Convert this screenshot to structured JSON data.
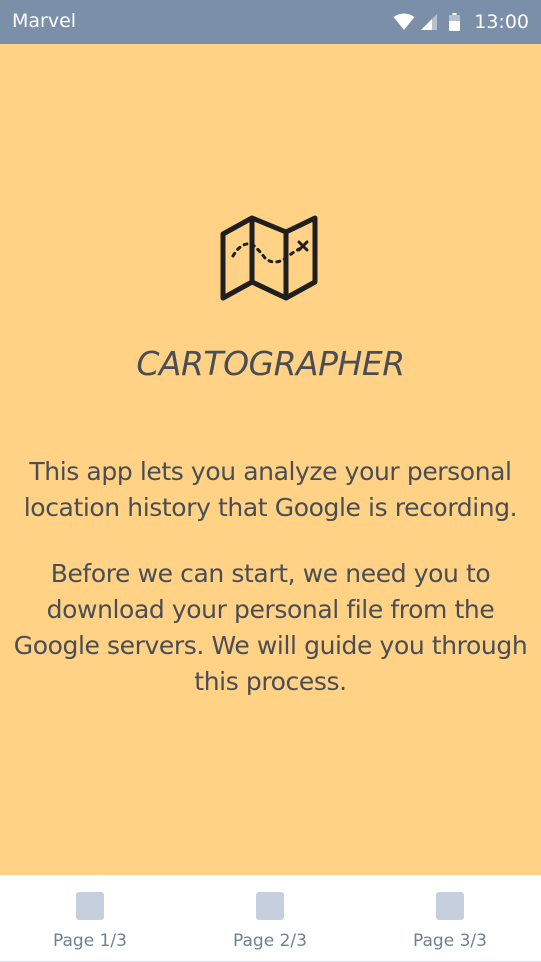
{
  "status_bar": {
    "carrier": "Marvel",
    "time": "13:00",
    "icons": [
      "wifi-icon",
      "signal-icon",
      "battery-icon"
    ]
  },
  "main": {
    "background_color": "#ffd285",
    "icon": "folded-map-icon",
    "title": "CARTOGRAPHER",
    "paragraph_1": "This app lets you analyze your personal location history that Google is recording.",
    "paragraph_2": "Before we can start, we need you to download your personal file from the Google servers. We will guide you through this process."
  },
  "bottom_nav": {
    "tabs": [
      {
        "label": "Page 1/3"
      },
      {
        "label": "Page 2/3"
      },
      {
        "label": "Page 3/3"
      }
    ]
  },
  "colors": {
    "status_bar": "#7b8fa8",
    "text": "#4b4d55",
    "tab_icon": "#c5cfdd"
  }
}
